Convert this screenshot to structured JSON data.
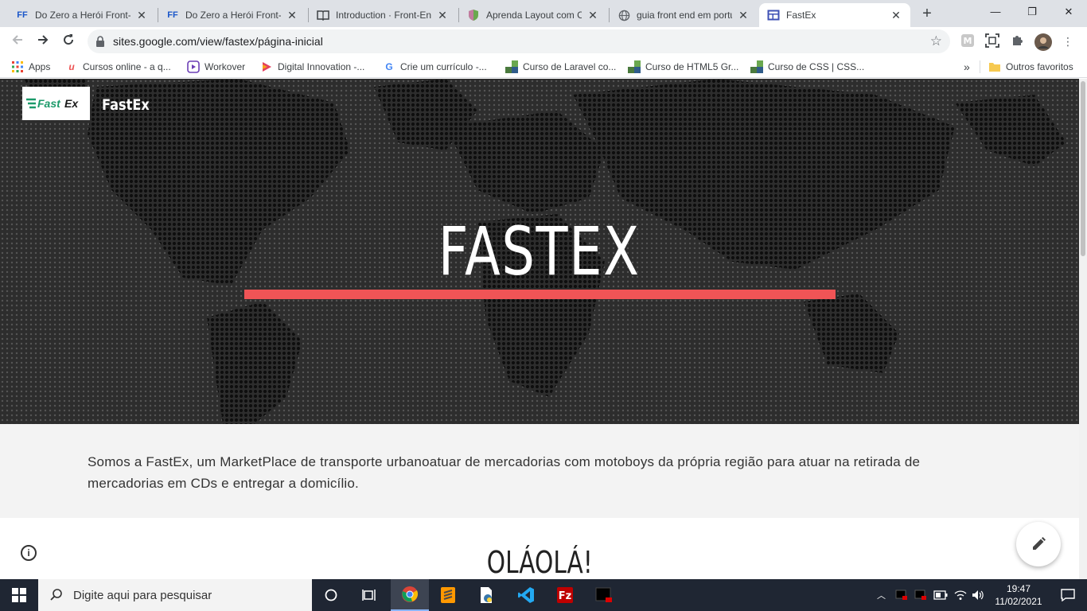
{
  "browser": {
    "tabs": [
      {
        "title": "Do Zero a Herói Front-E",
        "favicon": "FF",
        "active": false
      },
      {
        "title": "Do Zero a Herói Front-E",
        "favicon": "FF",
        "active": false
      },
      {
        "title": "Introduction · Front-End",
        "favicon": "book-icon",
        "active": false
      },
      {
        "title": "Aprenda Layout com CS",
        "favicon": "shield-icon",
        "active": false
      },
      {
        "title": "guia front end em portu",
        "favicon": "globe-icon",
        "active": false
      },
      {
        "title": "FastEx",
        "favicon": "sites-icon",
        "active": true
      }
    ],
    "url": "sites.google.com/view/fastex/página-inicial",
    "bookmarks": [
      {
        "label": "Apps",
        "icon": "apps-grid-icon"
      },
      {
        "label": "Cursos online - a q...",
        "icon": "udemy-icon"
      },
      {
        "label": "Workover",
        "icon": "play-icon"
      },
      {
        "label": "Digital Innovation -...",
        "icon": "dio-icon"
      },
      {
        "label": "Crie um currículo -...",
        "icon": "google-icon"
      },
      {
        "label": "Curso de Laravel co...",
        "icon": "blocks-icon"
      },
      {
        "label": "Curso de HTML5 Gr...",
        "icon": "blocks-icon"
      },
      {
        "label": "Curso de CSS | CSS...",
        "icon": "blocks-icon"
      }
    ],
    "other_bookmarks": "Outros favoritos",
    "overflow": "»"
  },
  "site": {
    "logo_text_a": "Fast",
    "logo_text_b": "Ex",
    "name": "FastEx",
    "hero_title": "FASTEX",
    "accent_color": "#f05456",
    "intro": "Somos a FastEx, um MarketPlace de transporte urbanoatuar de mercadorias com motoboys da própria região para atuar  na retirada de mercadorias em CDs e entregar a domicílio.",
    "section_title": "OLÁOLÁ!"
  },
  "taskbar": {
    "search_placeholder": "Digite aqui para pesquisar",
    "time": "19:47",
    "date": "11/02/2021"
  }
}
